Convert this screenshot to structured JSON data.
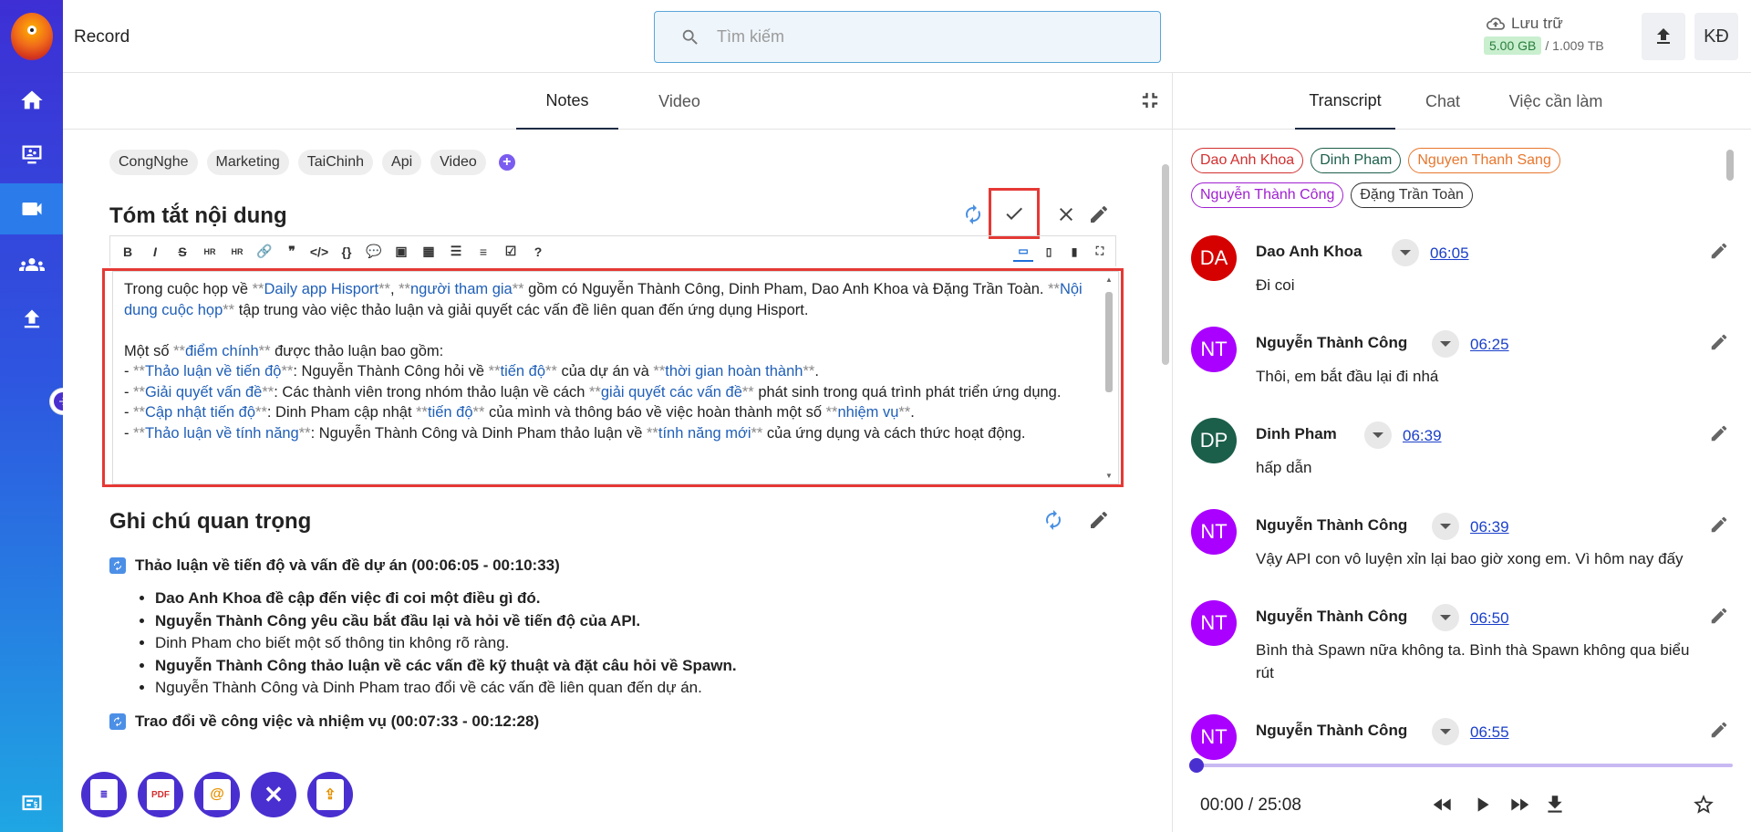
{
  "header": {
    "app_title": "Record",
    "search_placeholder": "Tìm kiếm",
    "storage_label": "Lưu trữ",
    "storage_used": "5.00 GB",
    "storage_total": "/ 1.009 TB",
    "user_initials": "KĐ"
  },
  "left": {
    "tabs": [
      "Notes",
      "Video"
    ],
    "tags": [
      "CongNghe",
      "Marketing",
      "TaiChinh",
      "Api",
      "Video"
    ],
    "summary_title": "Tóm tắt nội dung",
    "important_title": "Ghi chú quan trọng",
    "summary": {
      "p1_a": "Trong cuộc họp về ",
      "p1_b": "Daily app Hisport",
      "p1_c": ", ",
      "p1_d": "người tham gia",
      "p1_e": " gồm có Nguyễn Thành Công, Dinh Pham, Dao Anh Khoa và Đặng Trần Toàn. ",
      "p1_f": "Nội dung cuộc họp",
      "p1_g": " tập trung vào việc thảo luận và giải quyết các vấn đề liên quan đến ứng dụng Hisport.",
      "p2_a": "Một số ",
      "p2_b": "điểm chính",
      "p2_c": " được thảo luận bao gồm:",
      "l1_a": "Thảo luận về tiến độ",
      "l1_b": ": Nguyễn Thành Công hỏi về ",
      "l1_c": "tiến độ",
      "l1_d": " của dự án và ",
      "l1_e": "thời gian hoàn thành",
      "l2_a": "Giải quyết vấn đề",
      "l2_b": ": Các thành viên trong nhóm thảo luận về cách ",
      "l2_c": "giải quyết các vấn đề",
      "l2_d": " phát sinh trong quá trình phát triển ứng dụng.",
      "l3_a": "Cập nhật tiến độ",
      "l3_b": ": Dinh Pham cập nhật ",
      "l3_c": "tiến độ",
      "l3_d": " của mình và thông báo về việc hoàn thành một số ",
      "l3_e": "nhiệm vụ",
      "l4_a": "Thảo luận về tính năng",
      "l4_b": ": Nguyễn Thành Công và Dinh Pham thảo luận về ",
      "l4_c": "tính năng mới",
      "l4_d": " của ứng dụng và cách thức hoạt động."
    },
    "topics": [
      {
        "title": "Thảo luận về tiến độ và vấn đề dự án (00:06:05 - 00:10:33)",
        "items": [
          "Dao Anh Khoa đề cập đến việc đi coi một điều gì đó.",
          "Nguyễn Thành Công yêu cầu bắt đầu lại và hỏi về tiến độ của API.",
          "Dinh Pham cho biết một số thông tin không rõ ràng.",
          "Nguyễn Thành Công thảo luận về các vấn đề kỹ thuật và đặt câu hỏi về Spawn.",
          "Nguyễn Thành Công và Dinh Pham trao đổi về các vấn đề liên quan đến dự án."
        ]
      },
      {
        "title": "Trao đổi về công việc và nhiệm vụ (00:07:33 - 00:12:28)",
        "items": []
      }
    ],
    "export_pdf_label": "PDF"
  },
  "right": {
    "tabs": [
      "Transcript",
      "Chat",
      "Việc cần làm"
    ],
    "speakers": [
      {
        "name": "Dao Anh Khoa",
        "color": "#d32f2f"
      },
      {
        "name": "Dinh Pham",
        "color": "#1b5e4a"
      },
      {
        "name": "Nguyen Thanh Sang",
        "color": "#e8772e"
      },
      {
        "name": "Nguyễn Thành Công",
        "color": "#a020d0"
      },
      {
        "name": "Đặng Trần Toàn",
        "color": "#333333"
      }
    ],
    "entries": [
      {
        "initials": "DA",
        "name": "Dao Anh Khoa",
        "time": "06:05",
        "text": "Đi coi",
        "color": "#d50000"
      },
      {
        "initials": "NT",
        "name": "Nguyễn Thành Công",
        "time": "06:25",
        "text": "Thôi, em bắt đầu lại đi nhá",
        "color": "#aa00ff"
      },
      {
        "initials": "DP",
        "name": "Dinh Pham",
        "time": "06:39",
        "text": "hấp dẫn",
        "color": "#1b5e4a"
      },
      {
        "initials": "NT",
        "name": "Nguyễn Thành Công",
        "time": "06:39",
        "text": "Vậy API con vô luyện xỉn lại bao giờ xong em. Vì hôm nay đấy",
        "color": "#aa00ff"
      },
      {
        "initials": "NT",
        "name": "Nguyễn Thành Công",
        "time": "06:50",
        "text": "Bình thà Spawn nữa không ta. Bình thà Spawn không qua biểu rút",
        "color": "#aa00ff"
      },
      {
        "initials": "NT",
        "name": "Nguyễn Thành Công",
        "time": "06:55",
        "text": "",
        "color": "#aa00ff"
      }
    ],
    "player": {
      "current": "00:00",
      "total": "25:08",
      "readout": "00:00 / 25:08",
      "progress": 0
    }
  }
}
